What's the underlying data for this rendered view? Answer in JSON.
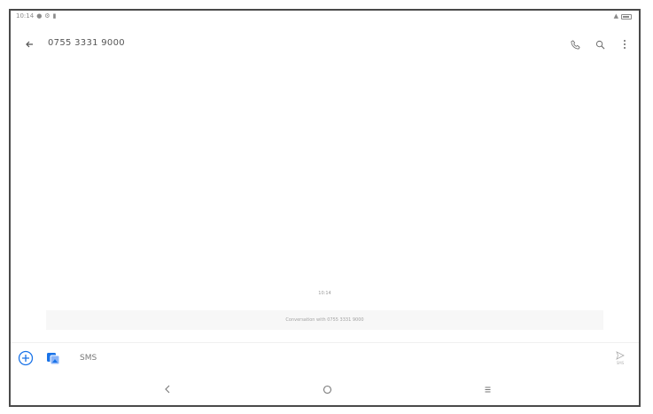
{
  "status_bar": {
    "time": "10:14",
    "left_icons": [
      "notification-icon",
      "wifi-icon",
      "settings-icon",
      "sim-icon"
    ],
    "right_icons": [
      "signal-icon",
      "battery-icon"
    ]
  },
  "app_bar": {
    "title": "0755 3331 9000",
    "actions": [
      "phone-icon",
      "search-icon",
      "more-vert-icon"
    ]
  },
  "conversation": {
    "timestamp": "10:14",
    "info_text": "Conversation with 0755 3331 9000"
  },
  "compose": {
    "placeholder": "SMS",
    "send_label": "SMS"
  },
  "nav_bar": {
    "buttons": [
      "back-icon",
      "home-icon",
      "recents-icon"
    ]
  },
  "colors": {
    "accent": "#1a73e8",
    "text": "#555555",
    "muted": "#9a9a9a",
    "strip": "#f7f7f7"
  }
}
